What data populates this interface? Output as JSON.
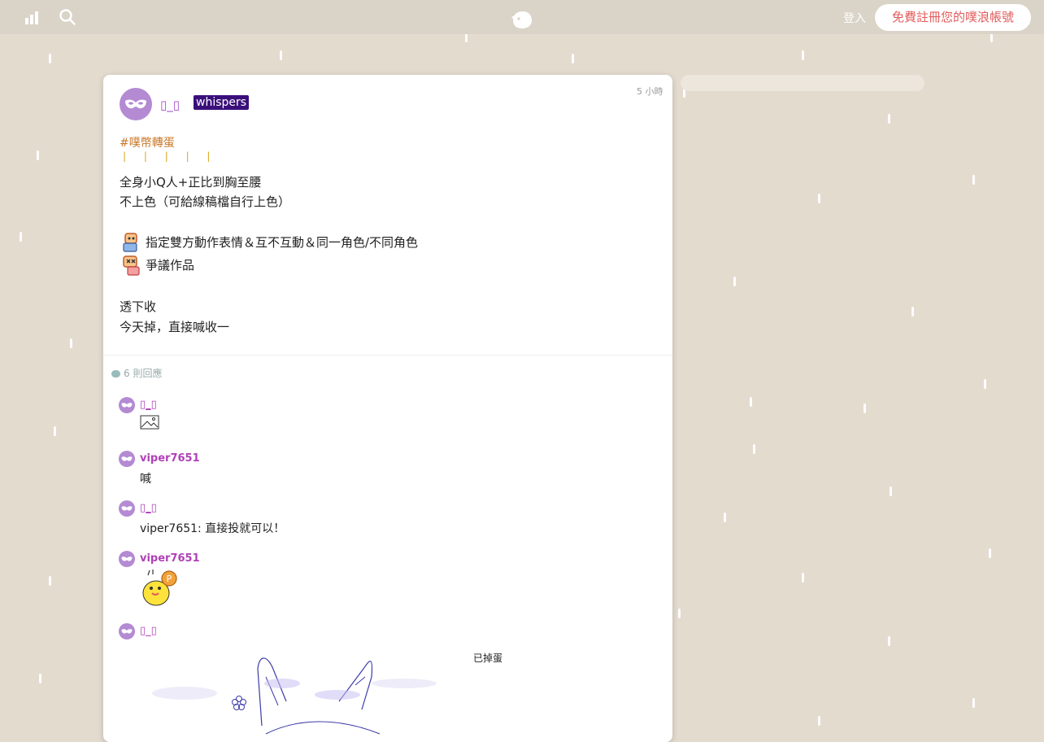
{
  "topbar": {
    "icons": [
      "chart-icon",
      "search-icon",
      "plurk-logo"
    ],
    "login_label": "登入",
    "signup_label": "免費註冊您的噗浪帳號"
  },
  "post": {
    "author": "▯_▯",
    "badge": "whispers",
    "time": "5 小時",
    "hashtag": "#噗幣轉蛋",
    "ticks": "| | | | |",
    "lines": [
      "全身小Q人+正比到胸至腰",
      "不上色（可給線稿檔自行上色）",
      "指定雙方動作表情＆互不互動＆同一角色/不同角色",
      "爭議作品",
      "透下收",
      "今天掉，直接喊收一"
    ],
    "replies_label": "6 則回應"
  },
  "replies": [
    {
      "name": "▯_▯",
      "content_type": "image-placeholder-icon"
    },
    {
      "name": "viper7651",
      "text": "喊"
    },
    {
      "name": "▯_▯",
      "text": "viper7651: 直接投就可以！"
    },
    {
      "name": "viper7651",
      "content_type": "duck-sticker"
    },
    {
      "name": "▯_▯",
      "caption": "已掉蛋"
    }
  ],
  "colors": {
    "background": "#e4dbcf",
    "topbar": "#dad3c7",
    "accent": "#e25c5c",
    "author": "#a64bc8",
    "badge": "#3a0f7a",
    "hashtag": "#c9792b"
  }
}
